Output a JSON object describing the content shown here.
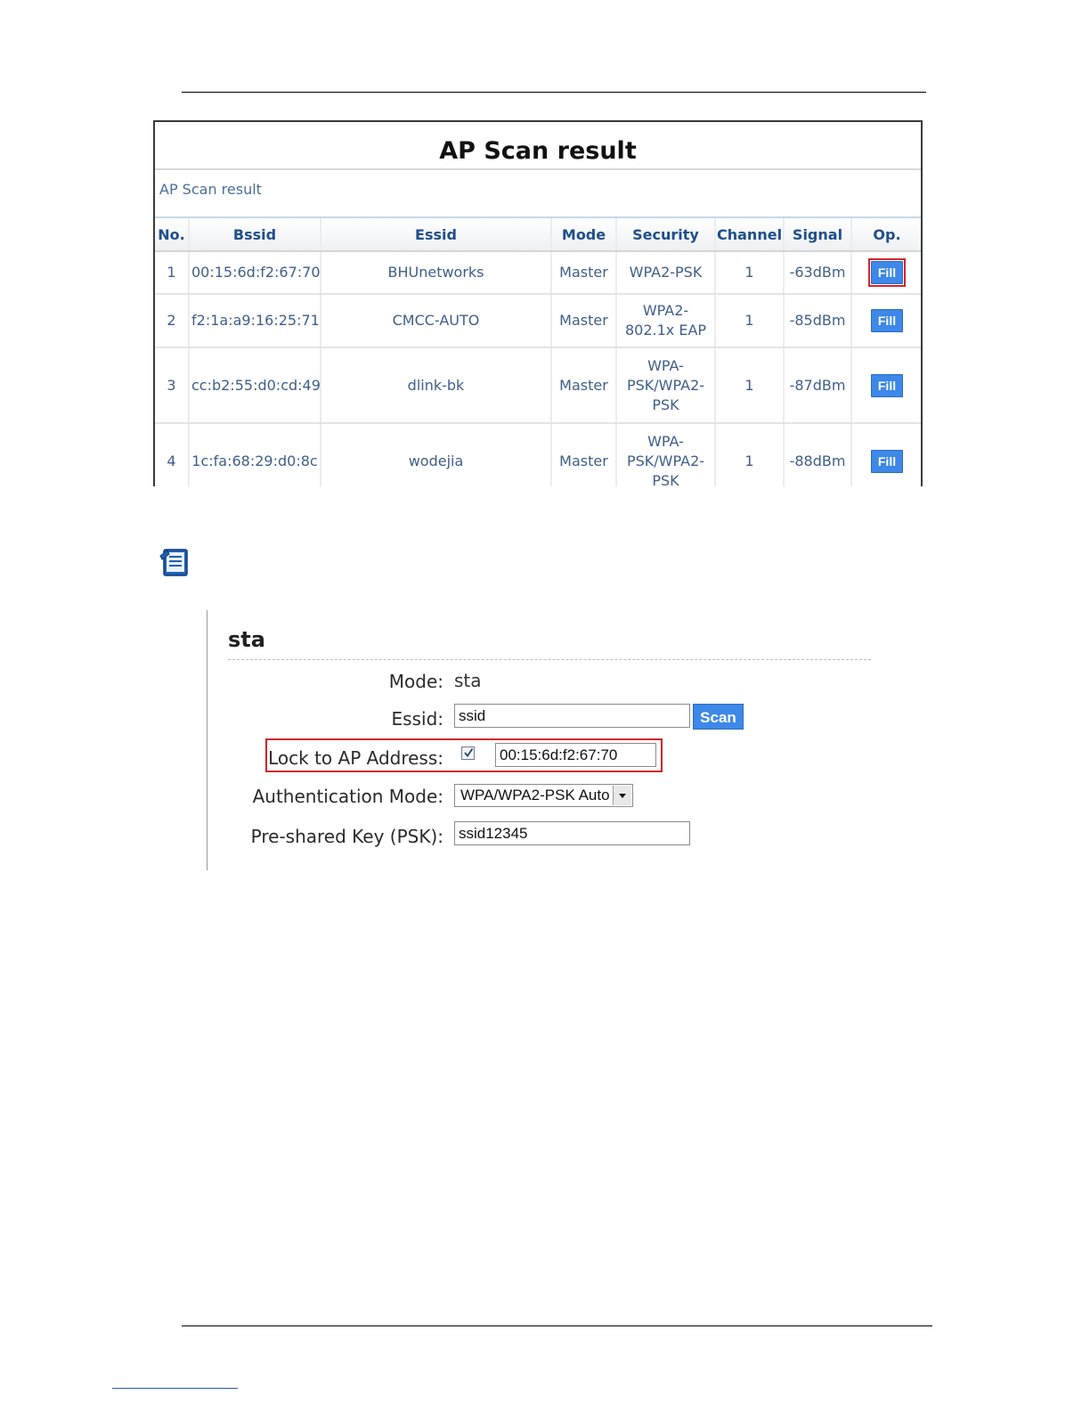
{
  "scan_panel": {
    "title": "AP Scan result",
    "subtitle": "AP Scan result",
    "columns": [
      "No.",
      "Bssid",
      "Essid",
      "Mode",
      "Security",
      "Channel",
      "Signal",
      "Op."
    ],
    "rows": [
      {
        "no": "1",
        "bssid": "00:15:6d:f2:67:70",
        "essid": "BHUnetworks",
        "mode": "Master",
        "security": "WPA2-PSK",
        "channel": "1",
        "signal": "-63dBm",
        "op": "Fill"
      },
      {
        "no": "2",
        "bssid": "f2:1a:a9:16:25:71",
        "essid": "CMCC-AUTO",
        "mode": "Master",
        "security": "WPA2-802.1x EAP",
        "channel": "1",
        "signal": "-85dBm",
        "op": "Fill"
      },
      {
        "no": "3",
        "bssid": "cc:b2:55:d0:cd:49",
        "essid": "dlink-bk",
        "mode": "Master",
        "security": "WPA-PSK/WPA2-PSK",
        "channel": "1",
        "signal": "-87dBm",
        "op": "Fill"
      },
      {
        "no": "4",
        "bssid": "1c:fa:68:29:d0:8c",
        "essid": "wodejia",
        "mode": "Master",
        "security": "WPA-PSK/WPA2-PSK",
        "channel": "1",
        "signal": "-88dBm",
        "op": "Fill"
      }
    ]
  },
  "sta_form": {
    "title": "sta",
    "mode_label": "Mode:",
    "mode_value": "sta",
    "essid_label": "Essid:",
    "essid_value": "ssid",
    "scan_button": "Scan",
    "lock_label": "Lock to AP Address:",
    "lock_checked": true,
    "lock_value": "00:15:6d:f2:67:70",
    "auth_label": "Authentication Mode:",
    "auth_value": "WPA/WPA2-PSK Auto",
    "psk_label": "Pre-shared Key (PSK):",
    "psk_value": "ssid12345"
  },
  "icons": {
    "note": "notepad-icon"
  },
  "colors": {
    "button_blue": "#3d88e8",
    "highlight_red": "#d2232a",
    "header_text": "#1e4f8a",
    "cell_text": "#3e5e8a"
  }
}
